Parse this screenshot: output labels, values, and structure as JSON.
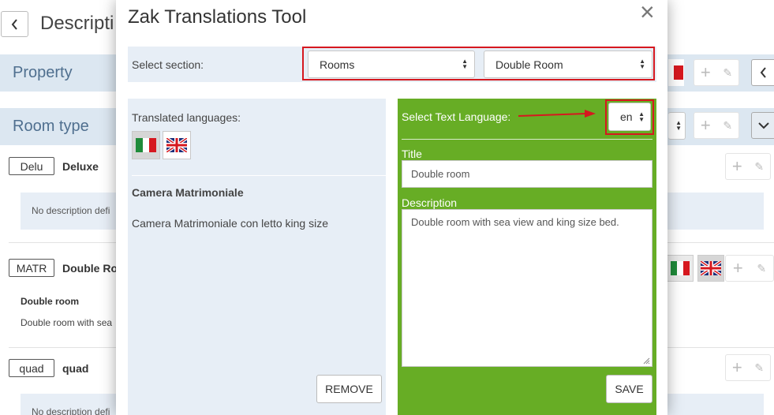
{
  "background": {
    "page_title": "Descripti",
    "back_icon": "chevron-left-icon",
    "sections": {
      "property": "Property",
      "room_type": "Room type"
    },
    "rooms": [
      {
        "code": "Delu",
        "name": "Deluxe",
        "description": "No description defi"
      },
      {
        "code": "MATR",
        "name": "Double Ro",
        "title": "Double room",
        "description": "Double room with sea"
      },
      {
        "code": "quad",
        "name": "quad",
        "description": "No description defi"
      }
    ],
    "icons": {
      "add": "+",
      "edit": "✎"
    }
  },
  "modal": {
    "title": "Zak Translations Tool",
    "close_label": "×",
    "select_section_label": "Select section:",
    "section_value": "Rooms",
    "item_value": "Double Room",
    "left": {
      "translated_languages_label": "Translated languages:",
      "flags": [
        "italy-flag-icon",
        "uk-flag-icon"
      ],
      "title": "Camera Matrimoniale",
      "description": "Camera Matrimoniale con letto king size",
      "remove_label": "REMOVE"
    },
    "right": {
      "select_text_language_label": "Select Text Language:",
      "language_value": "en",
      "title_label": "Title",
      "title_value": "Double room",
      "description_label": "Description",
      "description_value": "Double room with sea view and king size bed.",
      "save_label": "SAVE"
    }
  },
  "colors": {
    "accent_green": "#67ad25",
    "highlight_red": "#d6181f",
    "panel_blue": "#e7eef6",
    "section_blue": "#dce7f1"
  }
}
